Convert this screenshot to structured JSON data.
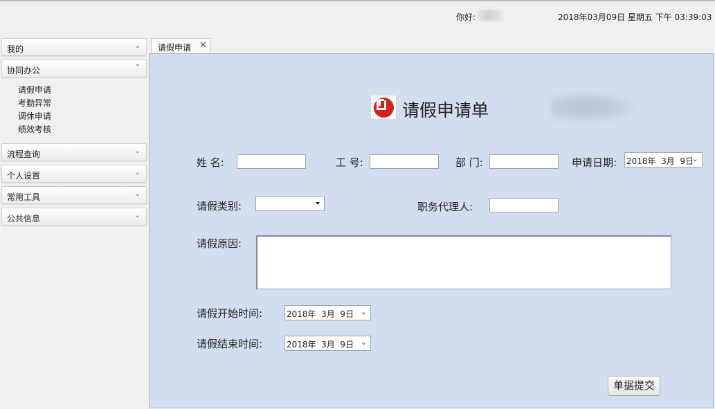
{
  "header": {
    "greeting": "你好:",
    "datetime": "2018年03月09日 星期五 下午 03:39:03"
  },
  "sidebar": {
    "sections": [
      {
        "label": "我的",
        "chevron": "⌄"
      },
      {
        "label": "协同办公",
        "chevron": "⌃"
      },
      {
        "label": "流程查询",
        "chevron": "⌄"
      },
      {
        "label": "个人设置",
        "chevron": "⌄"
      },
      {
        "label": "常用工具",
        "chevron": "⌄"
      },
      {
        "label": "公共信息",
        "chevron": "⌄"
      }
    ],
    "office_items": [
      "请假申请",
      "考勤异常",
      "调休申请",
      "绩效考核"
    ]
  },
  "tab": {
    "label": "请假申请",
    "close": "✕"
  },
  "form": {
    "title": "请假申请单",
    "name_label": "姓 名:",
    "name_value": "",
    "empno_label": "工 号:",
    "empno_value": "",
    "dept_label": "部 门:",
    "dept_value": "",
    "apply_date_label": "申请日期:",
    "apply_date_value": "2018年  3月  9日",
    "leave_type_label": "请假类别:",
    "leave_type_value": "",
    "agent_label": "职务代理人:",
    "agent_value": "",
    "reason_label": "请假原因:",
    "reason_value": "",
    "start_label": "请假开始时间:",
    "start_value": "2018年  3月  9日",
    "end_label": "请假结束时间:",
    "end_value": "2018年  3月  9日",
    "submit_label": "单据提交"
  },
  "icons": {
    "chevron_down": "chevron-down-icon",
    "chevron_up": "chevron-up-icon",
    "close": "close-icon",
    "logo": "company-logo",
    "dropdown": "dropdown-arrow-icon"
  },
  "colors": {
    "panel_bg": "#d2def0",
    "logo_red": "#d3201c"
  }
}
